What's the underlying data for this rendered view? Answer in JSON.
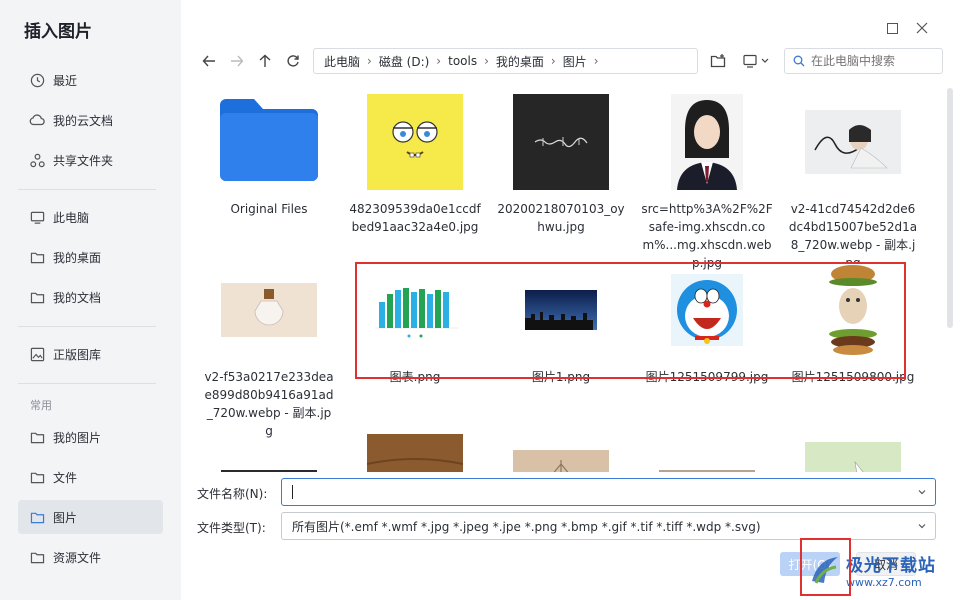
{
  "dialog": {
    "title": "插入图片"
  },
  "sidebar": {
    "items": [
      {
        "label": "最近",
        "icon": "clock-icon"
      },
      {
        "label": "我的云文档",
        "icon": "cloud-icon"
      },
      {
        "label": "共享文件夹",
        "icon": "share-icon"
      },
      {
        "label": "此电脑",
        "icon": "computer-icon"
      },
      {
        "label": "我的桌面",
        "icon": "folder-icon"
      },
      {
        "label": "我的文档",
        "icon": "folder-icon"
      },
      {
        "label": "正版图库",
        "icon": "gallery-icon"
      },
      {
        "label": "我的图片",
        "icon": "folder-icon"
      },
      {
        "label": "文件",
        "icon": "folder-icon"
      },
      {
        "label": "图片",
        "icon": "folder-icon",
        "active": true
      },
      {
        "label": "资源文件",
        "icon": "folder-icon"
      }
    ],
    "section_label": "常用"
  },
  "breadcrumb": {
    "items": [
      "此电脑",
      "磁盘 (D:)",
      "tools",
      "我的桌面",
      "图片"
    ]
  },
  "search": {
    "placeholder": "在此电脑中搜索"
  },
  "files": [
    {
      "name": "Original Files",
      "type": "folder"
    },
    {
      "name": "482309539da0e1ccdfbed91aac32a4e0.jpg",
      "type": "spongebob"
    },
    {
      "name": "20200218070103_oyhwu.jpg",
      "type": "dark"
    },
    {
      "name": "src=http%3A%2F%2Fsafe-img.xhscdn.com%...mg.xhscdn.webp.jpg",
      "type": "portrait"
    },
    {
      "name": "v2-41cd74542d2de6dc4bd15007be52d1a8_720w.webp - 副本.jpg",
      "type": "dancer"
    },
    {
      "name": "v2-f53a0217e233deae899d80b9416a91ad_720w.webp - 副本.jpg",
      "type": "bottle"
    },
    {
      "name": "图表.png",
      "type": "chart"
    },
    {
      "name": "图片1.png",
      "type": "city"
    },
    {
      "name": "图片1251509799.jpg",
      "type": "doraemon"
    },
    {
      "name": "图片1251509800.jpg",
      "type": "burger"
    },
    {
      "name": "",
      "type": "mountain"
    },
    {
      "name": "",
      "type": "leather"
    },
    {
      "name": "",
      "type": "bridge"
    },
    {
      "name": "",
      "type": "town"
    },
    {
      "name": "",
      "type": "green"
    }
  ],
  "form": {
    "filename_label": "文件名称(N):",
    "filename_value": "",
    "filetype_label": "文件类型(T):",
    "filetype_value": "所有图片(*.emf *.wmf *.jpg *.jpeg *.jpe *.png *.bmp *.gif *.tif *.tiff *.wdp *.svg)"
  },
  "buttons": {
    "open": "打开(O)",
    "cancel": "取消"
  },
  "watermark": {
    "top": "极光下载站",
    "bottom": "www.xz7.com"
  },
  "colors": {
    "accent": "#3a7bd5",
    "highlight": "#e03131",
    "folder": "#2f80ed"
  }
}
